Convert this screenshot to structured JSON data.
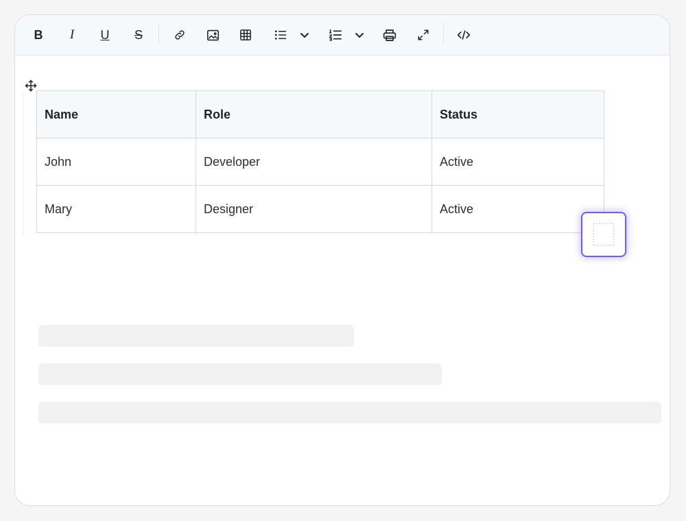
{
  "toolbar": {
    "buttons": [
      {
        "name": "bold-button",
        "label": "B"
      },
      {
        "name": "italic-button",
        "label": "I"
      },
      {
        "name": "underline-button",
        "label": "U"
      },
      {
        "name": "strikethrough-button",
        "label": "S"
      }
    ],
    "icons": [
      "bold-icon",
      "italic-icon",
      "underline-icon",
      "strikethrough-icon",
      "link-icon",
      "image-icon",
      "table-icon",
      "bullet-list-icon",
      "chevron-down-icon",
      "numbered-list-icon",
      "chevron-down-icon",
      "print-icon",
      "fullscreen-icon",
      "code-icon"
    ]
  },
  "table": {
    "headers": [
      "Name",
      "Role",
      "Status"
    ],
    "rows": [
      [
        "John",
        "Developer",
        "Active"
      ],
      [
        "Mary",
        "Designer",
        "Active"
      ]
    ]
  },
  "colors": {
    "accent": "#6d5df2",
    "border": "#d4d7dc",
    "skeleton": "#f1f1f2"
  }
}
